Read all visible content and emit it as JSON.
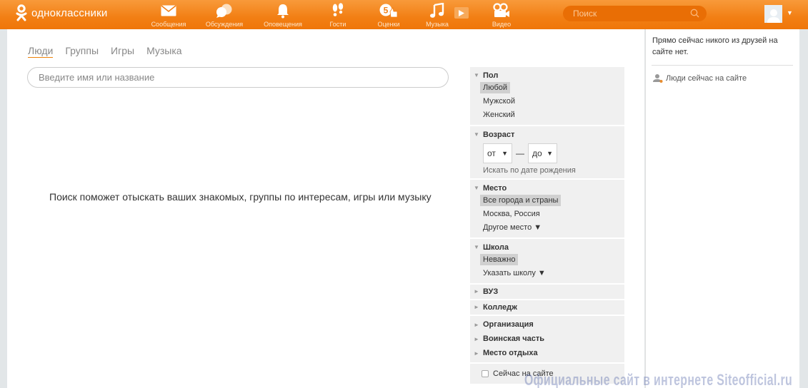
{
  "header": {
    "logo_text": "одноклассники",
    "nav": [
      {
        "label": "Сообщения",
        "icon": "envelope-icon"
      },
      {
        "label": "Обсуждения",
        "icon": "chat-bubbles-icon"
      },
      {
        "label": "Оповещения",
        "icon": "bell-icon"
      },
      {
        "label": "Гости",
        "icon": "footprints-icon"
      },
      {
        "label": "Оценки",
        "icon": "rating-icon"
      },
      {
        "label": "Музыка",
        "icon": "music-note-icon"
      },
      {
        "label": "Видео",
        "icon": "video-camera-icon"
      }
    ],
    "search_placeholder": "Поиск",
    "accent_color": "#f27f14"
  },
  "main": {
    "tabs": [
      {
        "label": "Люди",
        "active": true
      },
      {
        "label": "Группы",
        "active": false
      },
      {
        "label": "Игры",
        "active": false
      },
      {
        "label": "Музыка",
        "active": false
      }
    ],
    "search_placeholder": "Введите имя или название",
    "search_value": "",
    "hint": "Поиск поможет отыскать ваших знакомых, группы по интересам, игры или музыку"
  },
  "filters": {
    "gender": {
      "title": "Пол",
      "options": [
        {
          "label": "Любой",
          "selected": true
        },
        {
          "label": "Мужской",
          "selected": false
        },
        {
          "label": "Женский",
          "selected": false
        }
      ]
    },
    "age": {
      "title": "Возраст",
      "from": "от",
      "to": "до",
      "dash": "—",
      "birth_link": "Искать по дате рождения"
    },
    "place": {
      "title": "Место",
      "options": [
        {
          "label": "Все города и страны",
          "selected": true
        },
        {
          "label": "Москва, Россия",
          "selected": false
        },
        {
          "label": "Другое место ▼",
          "selected": false
        }
      ]
    },
    "school": {
      "title": "Школа",
      "options": [
        {
          "label": "Неважно",
          "selected": true
        },
        {
          "label": "Указать школу ▼",
          "selected": false
        }
      ]
    },
    "collapsed": [
      "ВУЗ",
      "Колледж",
      "Организация",
      "Воинская часть",
      "Место отдыха"
    ],
    "online_label": "Сейчас на сайте",
    "online_checked": false
  },
  "right": {
    "friends_message": "Прямо сейчас никого из друзей на сайте нет.",
    "people_online_link": "Люди сейчас на сайте"
  },
  "watermark": "Официальные сайт в интернете Siteofficial.ru"
}
